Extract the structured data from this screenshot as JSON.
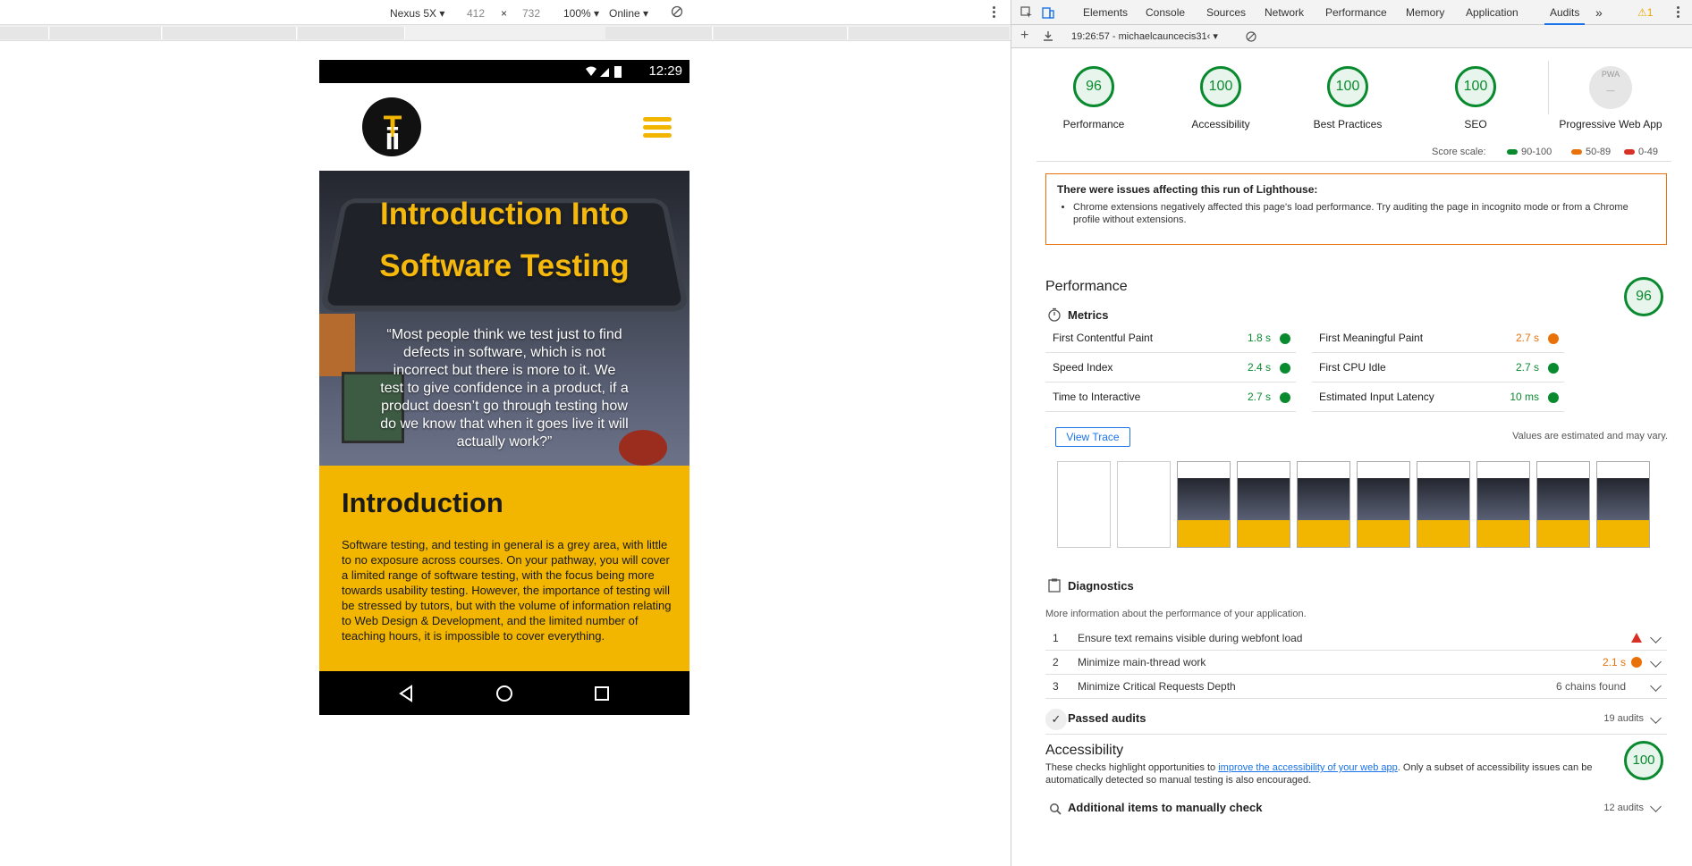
{
  "device_toolbar": {
    "device": "Nexus 5X ▾",
    "width": "412",
    "times": "×",
    "height": "732",
    "zoom": "100% ▾",
    "network": "Online ▾"
  },
  "phone": {
    "status_time": "12:29",
    "logo_text_a": "ii",
    "logo_text_b": "T",
    "hero_title_line1": "Introduction Into",
    "hero_title_line2": "Software Testing",
    "hero_quote": "“Most people think we test just to find defects in software, which is not incorrect but there is more to it. We test to give confidence in a product, if a product doesn’t go through testing how do we know that when it goes live it will actually work?”",
    "intro_heading": "Introduction",
    "intro_body": "Software testing, and testing in general is a grey area, with little to no exposure across courses. On your pathway, you will cover a limited range of software testing, with the focus being more towards usability testing. However, the importance of testing will be stressed by tutors, but with the volume of information relating to Web Design & Development, and the limited number of teaching hours, it is impossible to cover everything."
  },
  "devtools": {
    "tabs": [
      "Elements",
      "Console",
      "Sources",
      "Network",
      "Performance",
      "Memory",
      "Application",
      "Audits"
    ],
    "more_tabs": "»",
    "warning_count": "1",
    "report_label": "19:26:57 - michaelcauncecis31‹ ▾"
  },
  "scores": [
    {
      "label": "Performance",
      "value": "96"
    },
    {
      "label": "Accessibility",
      "value": "100"
    },
    {
      "label": "Best Practices",
      "value": "100"
    },
    {
      "label": "SEO",
      "value": "100"
    }
  ],
  "pwa": {
    "label": "Progressive Web App",
    "badge": "PWA"
  },
  "score_scale": {
    "label": "Score scale:",
    "high": "90-100",
    "mid": "50-89",
    "low": "0-49",
    "colors": {
      "high": "#0a8a2f",
      "mid": "#e8710a",
      "low": "#d93025"
    }
  },
  "warning": {
    "title": "There were issues affecting this run of Lighthouse:",
    "item": "Chrome extensions negatively affected this page's load performance. Try auditing the page in incognito mode or from a Chrome profile without extensions."
  },
  "performance": {
    "title": "Performance",
    "score": "96",
    "metrics_title": "Metrics",
    "metrics": [
      {
        "name": "First Contentful Paint",
        "value": "1.8 s",
        "status": "pass"
      },
      {
        "name": "First Meaningful Paint",
        "value": "2.7 s",
        "status": "average"
      },
      {
        "name": "Speed Index",
        "value": "2.4 s",
        "status": "pass"
      },
      {
        "name": "First CPU Idle",
        "value": "2.7 s",
        "status": "pass"
      },
      {
        "name": "Time to Interactive",
        "value": "2.7 s",
        "status": "pass"
      },
      {
        "name": "Estimated Input Latency",
        "value": "10 ms",
        "status": "pass"
      }
    ],
    "view_trace": "View Trace",
    "estimate_note": "Values are estimated and may vary.",
    "diagnostics_title": "Diagnostics",
    "diagnostics_desc": "More information about the performance of your application.",
    "diagnostics": [
      {
        "n": "1",
        "text": "Ensure text remains visible during webfont load",
        "value": ""
      },
      {
        "n": "2",
        "text": "Minimize main-thread work",
        "value": "2.1 s"
      },
      {
        "n": "3",
        "text": "Minimize Critical Requests Depth",
        "value": "6 chains found"
      }
    ],
    "passed_title": "Passed audits",
    "passed_count": "19 audits"
  },
  "accessibility": {
    "title": "Accessibility",
    "score": "100",
    "desc_before": "These checks highlight opportunities to ",
    "desc_link": "improve the accessibility of your web app",
    "desc_after": ". Only a subset of accessibility issues can be automatically detected so manual testing is also encouraged.",
    "manual_title": "Additional items to manually check",
    "manual_count": "12 audits"
  }
}
